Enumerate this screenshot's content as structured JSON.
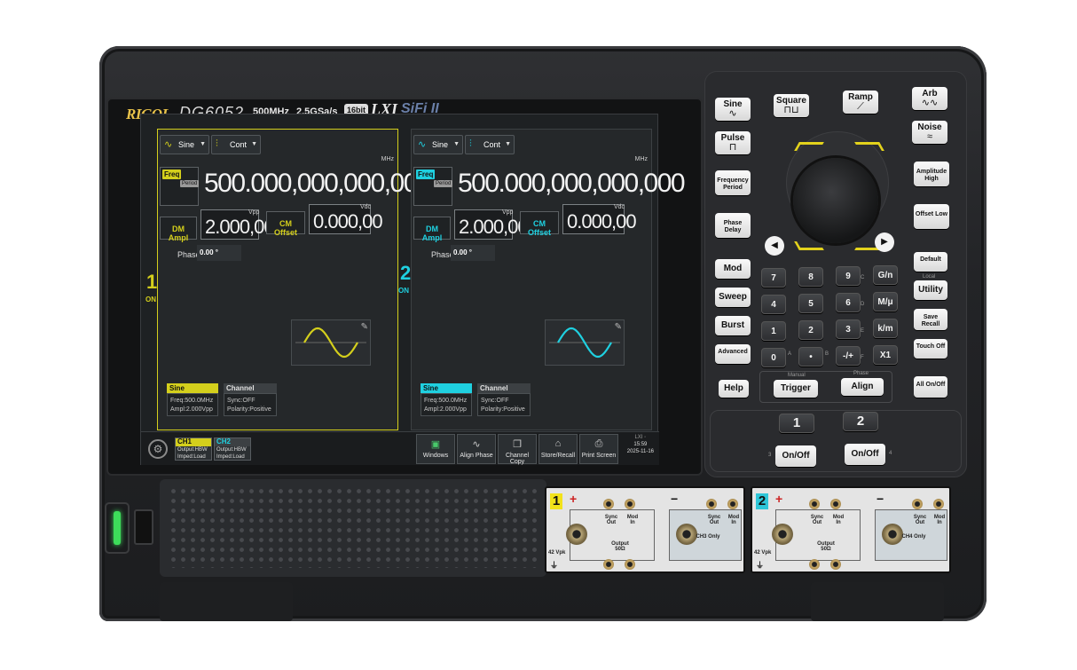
{
  "header": {
    "brand": "RIGOL",
    "model": "DG6052",
    "bandwidth": "500MHz",
    "sample_rate": "2.5GSa/s",
    "resolution": "16bit",
    "lxi": "LXI",
    "sifi": "SiFi II"
  },
  "channels": [
    {
      "number": "1",
      "state": "ON",
      "accent": "#d4cf1c",
      "waveform": "Sine",
      "mode": "Cont",
      "freq_tag": "Freq",
      "period_tag": "Period",
      "freq_value": "500.000,000,000,000",
      "freq_unit": "MHz",
      "ampl_label": "DM Ampl",
      "ampl_value": "2.000,00",
      "ampl_unit": "Vpp",
      "offset_label": "CM Offset",
      "offset_value": "0.000,00",
      "offset_unit": "Vdc",
      "phase_label": "Phase",
      "phase_value": "0.00 °",
      "summary_wave": "Sine",
      "summary_freq": "Freq:500.0MHz",
      "summary_ampl": "Ampl:2.000Vpp",
      "summary_ch_hdr": "Channel",
      "summary_sync": "Sync:OFF",
      "summary_polarity": "Polarity:Positive"
    },
    {
      "number": "2",
      "state": "ON",
      "accent": "#1fd0e0",
      "waveform": "Sine",
      "mode": "Cont",
      "freq_tag": "Freq",
      "period_tag": "Period",
      "freq_value": "500.000,000,000,000",
      "freq_unit": "MHz",
      "ampl_label": "DM Ampl",
      "ampl_value": "2.000,00",
      "ampl_unit": "Vpp",
      "offset_label": "CM Offset",
      "offset_value": "0.000,00",
      "offset_unit": "Vdc",
      "phase_label": "Phase",
      "phase_value": "0.00 °",
      "summary_wave": "Sine",
      "summary_freq": "Freq:500.0MHz",
      "summary_ampl": "Ampl:2.000Vpp",
      "summary_ch_hdr": "Channel",
      "summary_sync": "Sync:OFF",
      "summary_polarity": "Polarity:Positive"
    }
  ],
  "bottombar": {
    "ch1_tab": {
      "title": "CH1",
      "line1": "Output:HBW",
      "line2": "Imped:Load"
    },
    "ch2_tab": {
      "title": "CH2",
      "line1": "Output:HBW",
      "line2": "Imped:Load"
    },
    "buttons": [
      "Windows",
      "Align Phase",
      "Channel Copy",
      "Store/Recall",
      "Print Screen"
    ],
    "clock_time": "15:59",
    "clock_date": "2025-11-16"
  },
  "panel": {
    "waves": [
      "Sine",
      "Square",
      "Ramp",
      "Arb",
      "Pulse",
      "Noise"
    ],
    "left_params": [
      "Frequency Period",
      "Phase Delay"
    ],
    "right_params": [
      "Amplitude High",
      "Offset Low"
    ],
    "func_keys": [
      "Mod",
      "Sweep",
      "Burst",
      "Advanced"
    ],
    "numpad": [
      "7",
      "8",
      "9",
      "G/n",
      "4",
      "5",
      "6",
      "M/μ",
      "1",
      "2",
      "3",
      "k/m",
      "0",
      "•",
      "-/+",
      "X1"
    ],
    "hex_letters": [
      "A",
      "B",
      "C",
      "D",
      "E",
      "F"
    ],
    "side_keys": [
      "Default",
      "Utility",
      "Save Recall",
      "Touch Off"
    ],
    "local_label": "Local",
    "help": "Help",
    "manual_label": "Manual",
    "trigger": "Trigger",
    "phase_label": "Phase",
    "align": "Align",
    "all_onoff": "All On/Off",
    "ch1_key": "1",
    "ch2_key": "2",
    "onoff": "On/Off",
    "ch_small_3": "3",
    "ch_small_4": "4"
  },
  "outputs": [
    {
      "num": "1",
      "color": "#f2e21a",
      "sync": "Sync Out",
      "mod": "Mod In",
      "output": "Output 50Ω",
      "only": "CH3 Only",
      "vpk": "42 Vpk"
    },
    {
      "num": "2",
      "color": "#2ec6d8",
      "sync": "Sync Out",
      "mod": "Mod In",
      "output": "Output 50Ω",
      "only": "CH4 Only",
      "vpk": "42 Vpk"
    }
  ]
}
